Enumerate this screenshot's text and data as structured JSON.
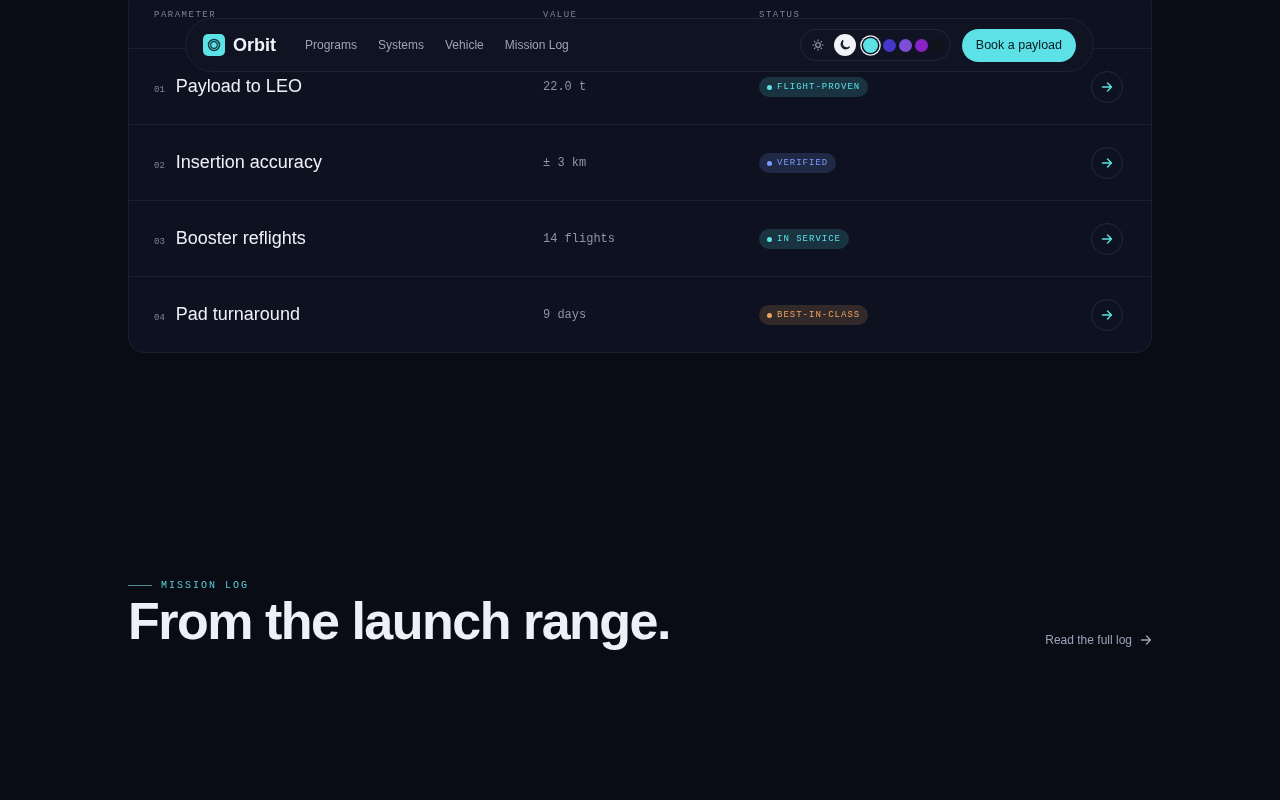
{
  "nav": {
    "brand": "Orbit",
    "links": [
      "Programs",
      "Systems",
      "Vehicle",
      "Mission Log"
    ],
    "theme_modes": [
      {
        "kind": "light",
        "selected": false
      },
      {
        "kind": "dark",
        "selected": true
      }
    ],
    "swatches": [
      {
        "color": "#5ce1e6",
        "selected": true
      },
      {
        "color": "#4338ca",
        "selected": false
      },
      {
        "color": "#7c4dd6",
        "selected": false
      },
      {
        "color": "#8b21c9",
        "selected": false
      },
      {
        "color": "#111318",
        "selected": false
      }
    ],
    "cta": "Book a payload"
  },
  "table": {
    "columns": [
      "PARAMETER",
      "VALUE",
      "STATUS"
    ],
    "rows": [
      {
        "index": "01",
        "parameter": "Payload to LEO",
        "value": "22.0 t",
        "status": "FLIGHT-PROVEN",
        "color": "#5ce1e6"
      },
      {
        "index": "02",
        "parameter": "Insertion accuracy",
        "value": "± 3 km",
        "status": "VERIFIED",
        "color": "#7b9cff"
      },
      {
        "index": "03",
        "parameter": "Booster reflights",
        "value": "14 flights",
        "status": "IN SERVICE",
        "color": "#5ce1e6"
      },
      {
        "index": "04",
        "parameter": "Pad turnaround",
        "value": "9 days",
        "status": "BEST-IN-CLASS",
        "color": "#f0a45c"
      }
    ]
  },
  "section": {
    "eyebrow": "MISSION LOG",
    "heading": "From the launch range.",
    "link": "Read the full log"
  }
}
